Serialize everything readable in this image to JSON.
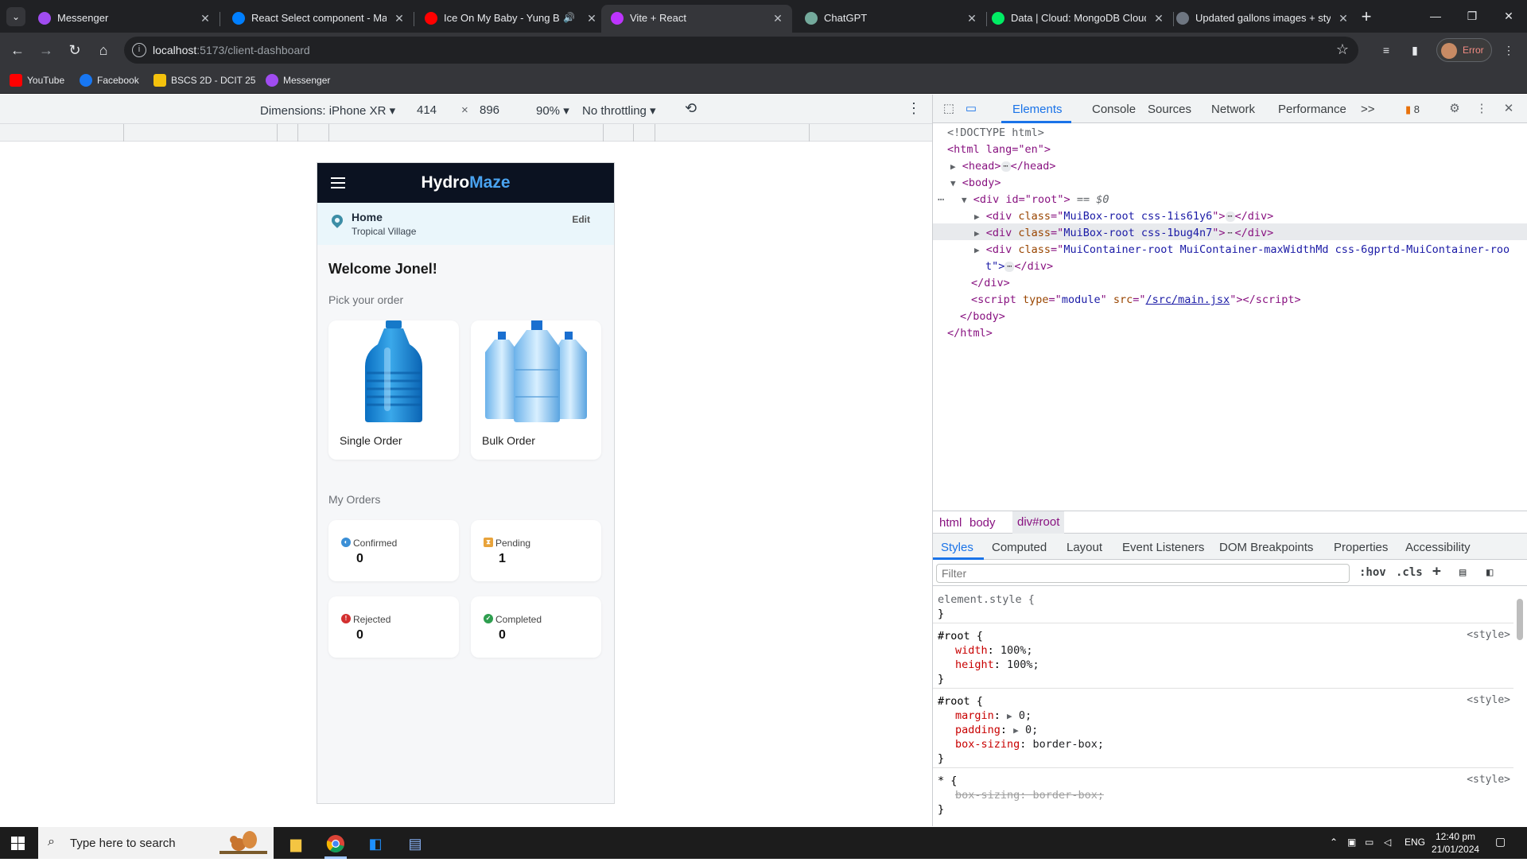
{
  "browser": {
    "tabs": [
      {
        "title": "Messenger",
        "icon": "messenger-icon",
        "color": "#a04cf0"
      },
      {
        "title": "React Select component - Mate",
        "icon": "mui-icon",
        "color": "#007fff"
      },
      {
        "title": "Ice On My Baby - Yung Bleu",
        "icon": "youtube-icon",
        "color": "#ff0000"
      },
      {
        "title": "Vite + React",
        "icon": "vite-icon",
        "color": "#bd34fe"
      },
      {
        "title": "ChatGPT",
        "icon": "chatgpt-icon",
        "color": "#74aa9c"
      },
      {
        "title": "Data | Cloud: MongoDB Cloud",
        "icon": "mongodb-icon",
        "color": "#00ed64"
      },
      {
        "title": "Updated gallons images + styli",
        "icon": "github-icon",
        "color": "#6e7681"
      }
    ],
    "url_host": "localhost",
    "url_path": ":5173/client-dashboard",
    "profile_label": "Error",
    "bookmarks": [
      {
        "label": "YouTube",
        "color": "#ff0000"
      },
      {
        "label": "Facebook",
        "color": "#1877f2"
      },
      {
        "label": "BSCS 2D - DCIT 25",
        "color": "#f4c20d"
      },
      {
        "label": "Messenger",
        "color": "#a04cf0"
      }
    ]
  },
  "device_toolbar": {
    "dimensions": "Dimensions: iPhone XR",
    "width": "414",
    "height": "896",
    "zoom": "90%",
    "throttle": "No throttling"
  },
  "app": {
    "brand_part1": "Hydro",
    "brand_part2": "Maze",
    "location_title": "Home",
    "location_sub": "Tropical Village",
    "edit_label": "Edit",
    "welcome": "Welcome Jonel!",
    "pick_label": "Pick your order",
    "order_types": [
      {
        "label": "Single Order"
      },
      {
        "label": "Bulk Order"
      }
    ],
    "my_orders_label": "My Orders",
    "statuses": [
      {
        "label": "Confirmed",
        "count": "0",
        "color": "#3b8fd6"
      },
      {
        "label": "Pending",
        "count": "1",
        "color": "#e8a33b"
      },
      {
        "label": "Rejected",
        "count": "0",
        "color": "#d32f2f"
      },
      {
        "label": "Completed",
        "count": "0",
        "color": "#2e9e4f"
      }
    ]
  },
  "devtools": {
    "tabs": [
      "Elements",
      "Console",
      "Sources",
      "Network",
      "Performance"
    ],
    "more": ">>",
    "issues_count": "8",
    "dom": {
      "doctype": "<!DOCTYPE html>",
      "html_open": "<html lang=\"en\">",
      "head": "<head>",
      "head_close": "</head>",
      "body": "<body>",
      "root": "<div id=\"root\">",
      "root_marker": "== $0",
      "child1_class": "MuiBox-root css-1is61y6",
      "child2_class": "MuiBox-root css-1bug4n7",
      "child3_class": "MuiContainer-root MuiContainer-maxWidthMd css-6gprtd-MuiContainer-roo",
      "child3_wrap": "t\">",
      "div_close": "</div>",
      "script_src": "/src/main.jsx",
      "body_close": "</body>",
      "html_close": "</html>"
    },
    "crumbs": [
      "html",
      "body",
      "div#root"
    ],
    "subtabs": [
      "Styles",
      "Computed",
      "Layout",
      "Event Listeners",
      "DOM Breakpoints",
      "Properties",
      "Accessibility"
    ],
    "filter_placeholder": "Filter",
    "hov": ":hov",
    "cls": ".cls",
    "rules": {
      "element_style": "element.style {",
      "root_sel": "#root {",
      "width": "width",
      "width_val": "100%;",
      "height": "height",
      "height_val": "100%;",
      "margin": "margin",
      "margin_val": "0;",
      "padding": "padding",
      "padding_val": "0;",
      "box_sizing": "box-sizing",
      "box_sizing_val": "border-box;",
      "star_sel": "* {",
      "close": "}",
      "source": "<style>"
    }
  },
  "taskbar": {
    "search_placeholder": "Type here to search",
    "lang": "ENG",
    "time": "12:40 pm",
    "date": "21/01/2024"
  }
}
